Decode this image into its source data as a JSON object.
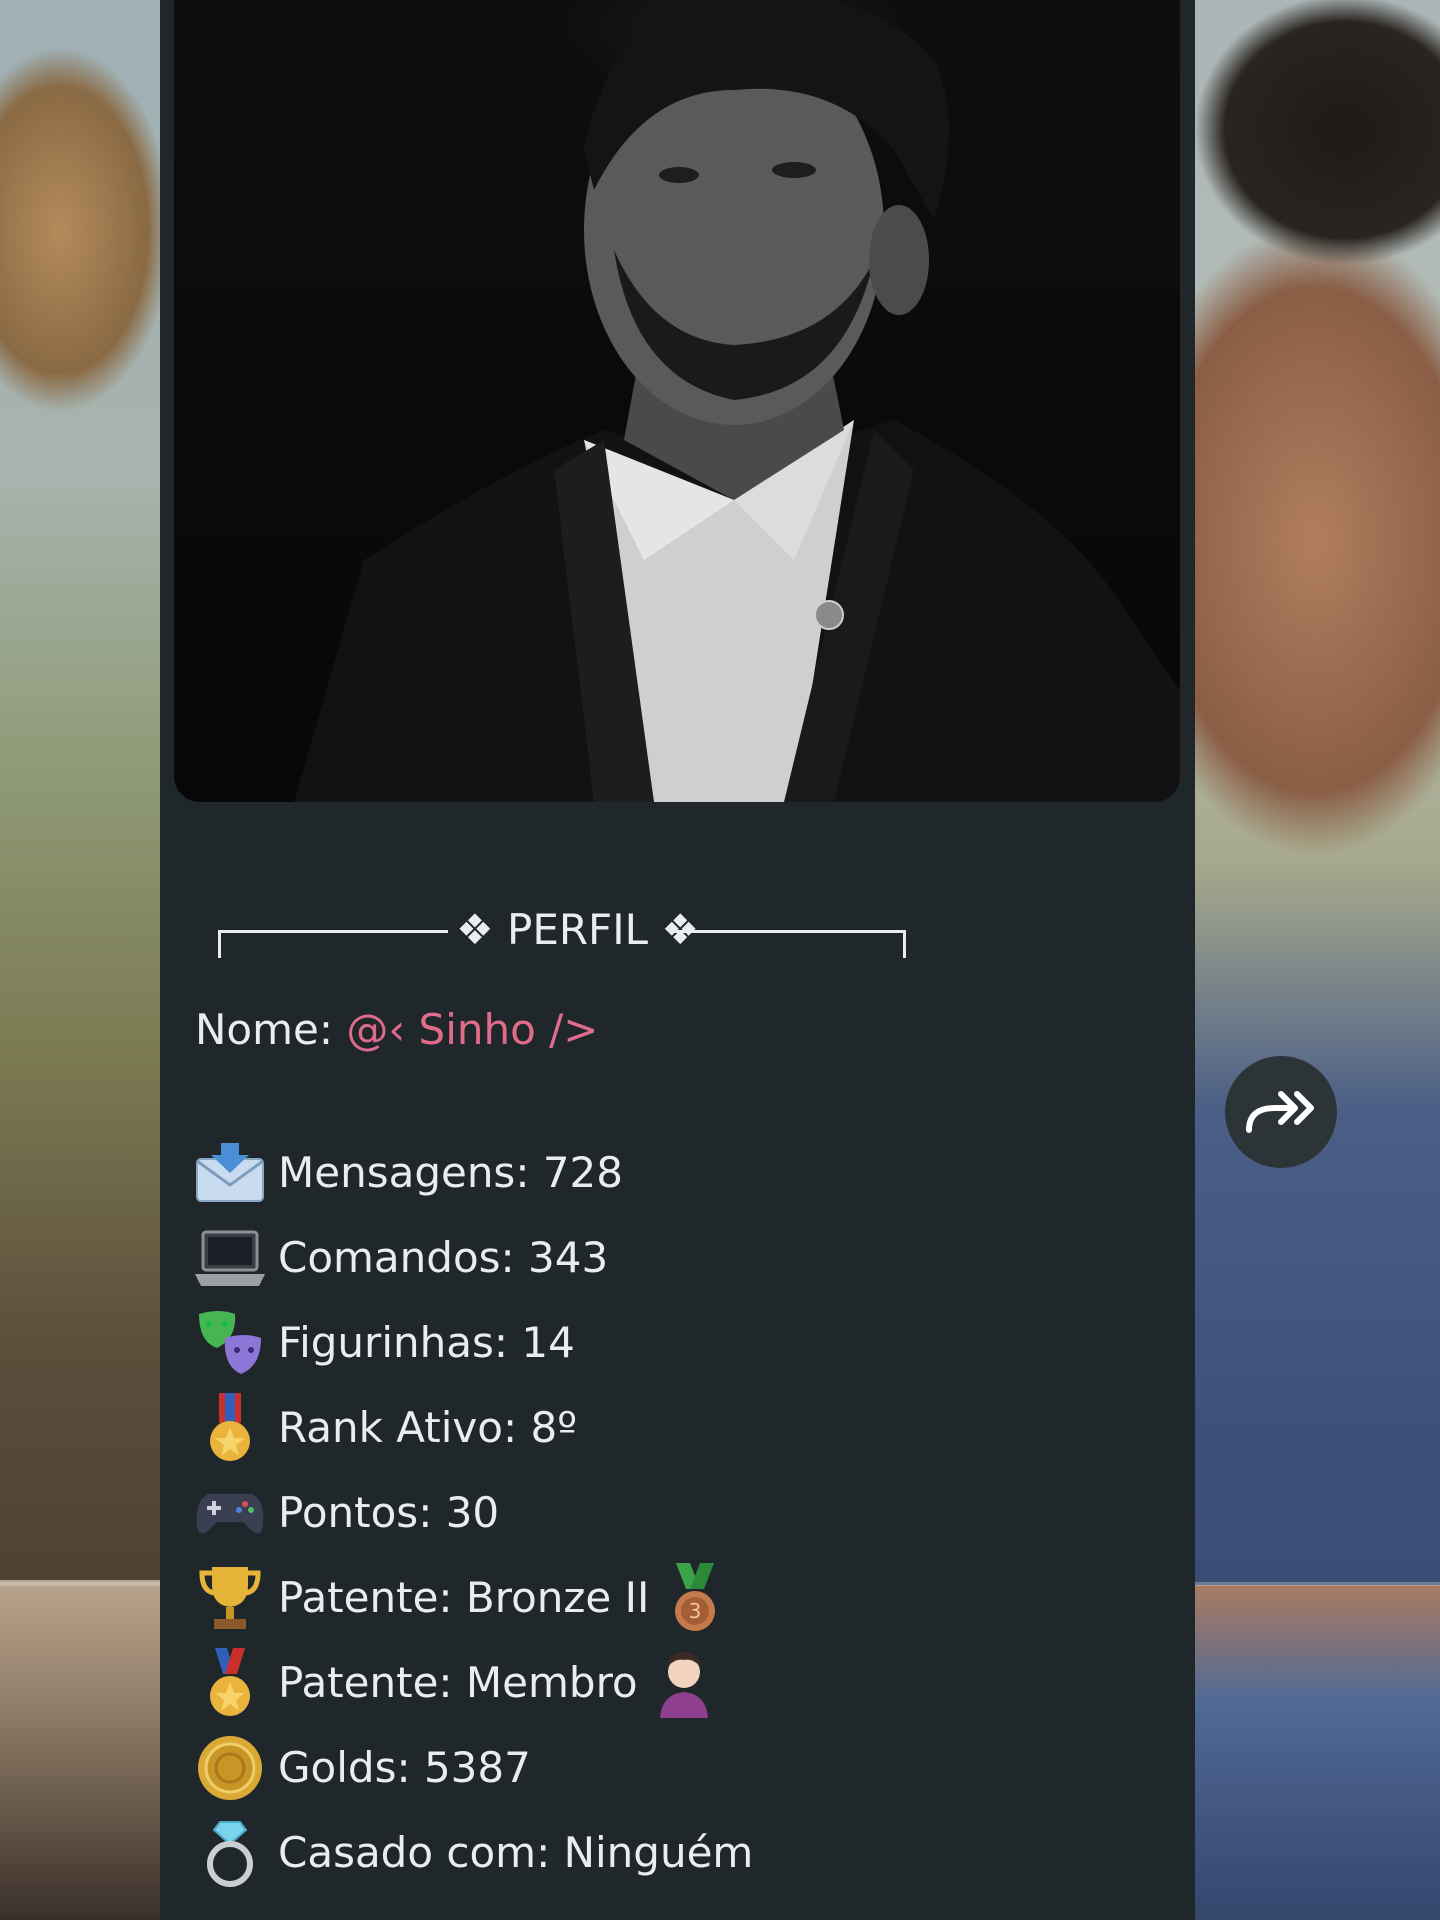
{
  "header": {
    "title": "❖ PERFIL ❖"
  },
  "profile": {
    "name_label": "Nome:",
    "name_value": "@‹ Sinho />"
  },
  "stats": [
    {
      "icon": "envelope-icon",
      "label": "Mensagens: 728"
    },
    {
      "icon": "laptop-icon",
      "label": "Comandos: 343"
    },
    {
      "icon": "theater-masks-icon",
      "label": "Figurinhas: 14"
    },
    {
      "icon": "military-medal-icon",
      "label": "Rank Ativo: 8º"
    },
    {
      "icon": "gamepad-icon",
      "label": "Pontos: 30"
    },
    {
      "icon": "trophy-icon",
      "label": "Patente: Bronze II",
      "trailing_icon": "bronze-medal-icon"
    },
    {
      "icon": "military-medal-icon",
      "label": "Patente: Membro",
      "trailing_icon": "person-shrugging-icon"
    },
    {
      "icon": "gold-coin-icon",
      "label": "Golds: 5387"
    },
    {
      "icon": "ring-icon",
      "label": "Casado com: Ninguém"
    }
  ],
  "actions": {
    "forward_icon": "forward-icon"
  },
  "colors": {
    "bubble": "#1f272b",
    "text": "#e9edef",
    "mention": "#e06b8b",
    "forward_button": "#2c3438"
  }
}
